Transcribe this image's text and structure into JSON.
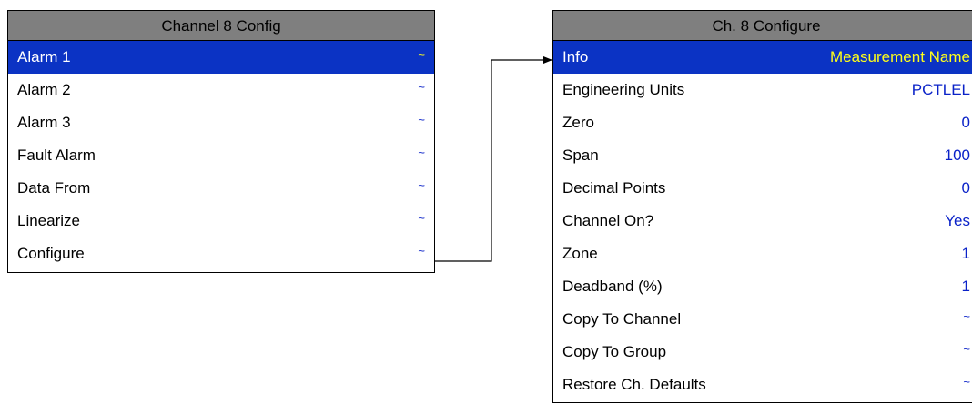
{
  "left_panel": {
    "title": "Channel 8 Config",
    "items": [
      {
        "label": "Alarm 1",
        "value": "~",
        "selected": true
      },
      {
        "label": "Alarm 2",
        "value": "~",
        "selected": false
      },
      {
        "label": "Alarm 3",
        "value": "~",
        "selected": false
      },
      {
        "label": "Fault Alarm",
        "value": "~",
        "selected": false
      },
      {
        "label": "Data From",
        "value": "~",
        "selected": false
      },
      {
        "label": "Linearize",
        "value": "~",
        "selected": false
      },
      {
        "label": "Configure",
        "value": "~",
        "selected": false
      }
    ]
  },
  "right_panel": {
    "title": "Ch. 8 Configure",
    "items": [
      {
        "label": "Info",
        "value": "Measurement Name",
        "selected": true
      },
      {
        "label": "Engineering Units",
        "value": "PCTLEL",
        "selected": false
      },
      {
        "label": "Zero",
        "value": "0",
        "selected": false
      },
      {
        "label": "Span",
        "value": "100",
        "selected": false
      },
      {
        "label": "Decimal Points",
        "value": "0",
        "selected": false
      },
      {
        "label": "Channel On?",
        "value": "Yes",
        "selected": false
      },
      {
        "label": "Zone",
        "value": "1",
        "selected": false
      },
      {
        "label": "Deadband (%)",
        "value": "1",
        "selected": false
      },
      {
        "label": "Copy To Channel",
        "value": "~",
        "selected": false
      },
      {
        "label": "Copy To Group",
        "value": "~",
        "selected": false
      },
      {
        "label": "Restore Ch. Defaults",
        "value": "~",
        "selected": false
      }
    ]
  },
  "colors": {
    "header_bg": "#7f7f7f",
    "selected_bg": "#0b33c4",
    "selected_text": "#ffffff",
    "selected_value": "#ffff1a",
    "value_text": "#0a22c8"
  },
  "connector": {
    "from": "left_panel.items.6",
    "to": "right_panel.items.0"
  }
}
